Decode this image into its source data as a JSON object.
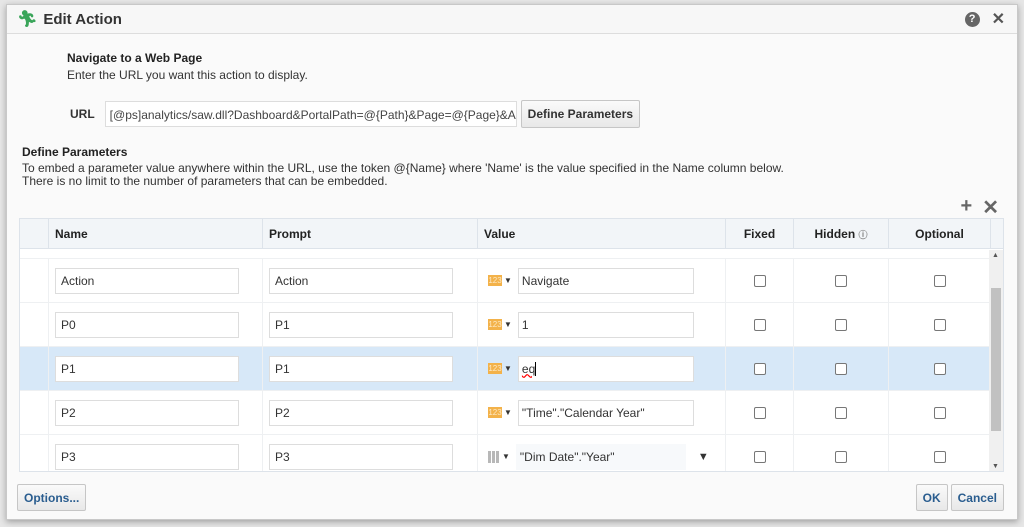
{
  "dialog": {
    "title": "Edit Action",
    "icon": "running-man-icon"
  },
  "intro": {
    "heading": "Navigate to a Web Page",
    "text": "Enter the URL you want this action to display."
  },
  "url": {
    "label": "URL",
    "value": "[@ps]analytics/saw.dll?Dashboard&PortalPath=@{Path}&Page=@{Page}&Action=@{Action}",
    "button": "Define Parameters"
  },
  "params": {
    "heading": "Define Parameters",
    "line1": "To embed a parameter value anywhere within the URL, use the token @{Name} where 'Name' is the value specified in the Name column below.",
    "line2": "There is no limit to the number of parameters that can be embedded."
  },
  "table": {
    "headers": {
      "name": "Name",
      "prompt": "Prompt",
      "value": "Value",
      "fixed": "Fixed",
      "hidden": "Hidden",
      "optional": "Optional"
    },
    "rows": [
      {
        "name": "Action",
        "prompt": "Action",
        "type": "123",
        "value": "Navigate",
        "fixed": false,
        "hidden": false,
        "optional": false
      },
      {
        "name": "P0",
        "prompt": "P1",
        "type": "123",
        "value": "1",
        "fixed": false,
        "hidden": false,
        "optional": false
      },
      {
        "name": "P1",
        "prompt": "P1",
        "type": "123",
        "value": "eq",
        "fixed": false,
        "hidden": false,
        "optional": false,
        "selected": true
      },
      {
        "name": "P2",
        "prompt": "P2",
        "type": "123",
        "value": "\"Time\".\"Calendar Year\"",
        "fixed": false,
        "hidden": false,
        "optional": false
      },
      {
        "name": "P3",
        "prompt": "P3",
        "type": "column",
        "value": "\"Dim Date\".\"Year\"",
        "fixed": false,
        "hidden": false,
        "optional": false
      }
    ]
  },
  "footer": {
    "options": "Options...",
    "ok": "OK",
    "cancel": "Cancel"
  },
  "colors": {
    "selected_row": "#d7e8f8",
    "type_badge": "#f3b24a",
    "button_text": "#2a5d8f",
    "title_icon": "#3aa55a"
  }
}
